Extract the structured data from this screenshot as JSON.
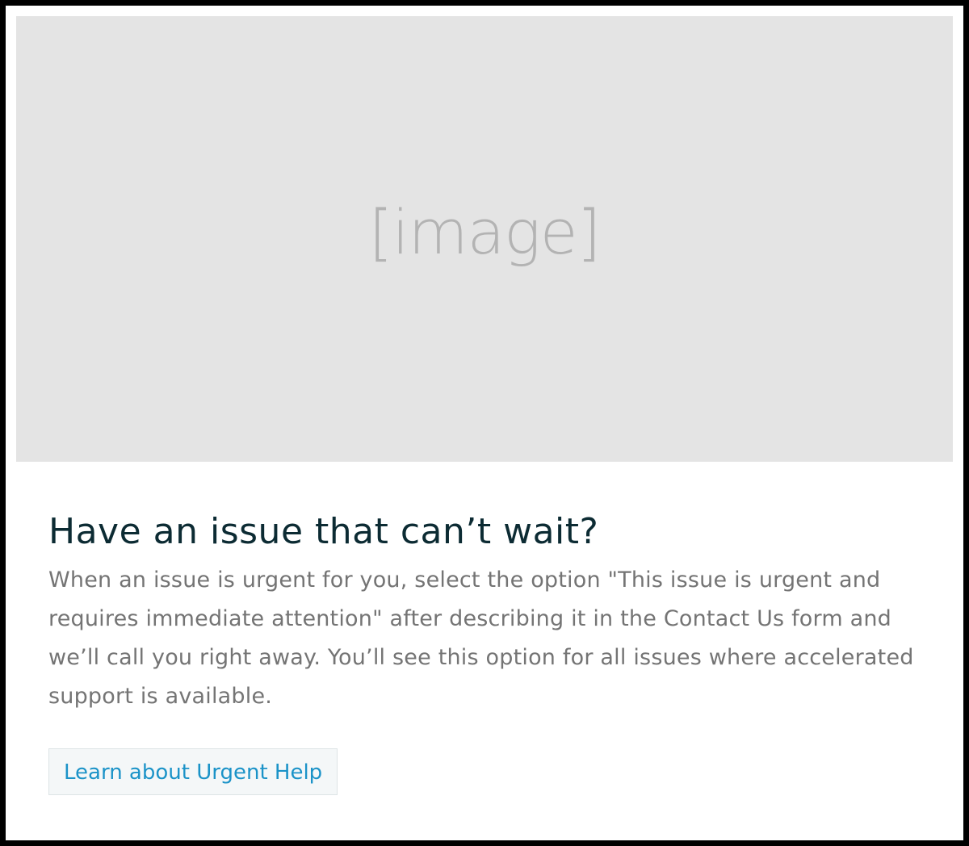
{
  "hero": {
    "placeholder_label": "[image]"
  },
  "card": {
    "title": "Have an issue that can’t wait?",
    "body": "When an issue is urgent for you, select the option \"This issue is urgent and requires immediate attention\" after describing it in the Contact Us form and we’ll call you right away. You’ll see this option for all issues where accelerated support is available.",
    "cta_label": "Learn about Urgent Help"
  },
  "colors": {
    "page_border": "#000000",
    "card_background": "#ffffff",
    "image_placeholder_bg": "#e4e4e4",
    "title": "#0c2b33",
    "body_text": "#747474",
    "link": "#1b93c8",
    "button_bg": "#f4f7f8"
  }
}
